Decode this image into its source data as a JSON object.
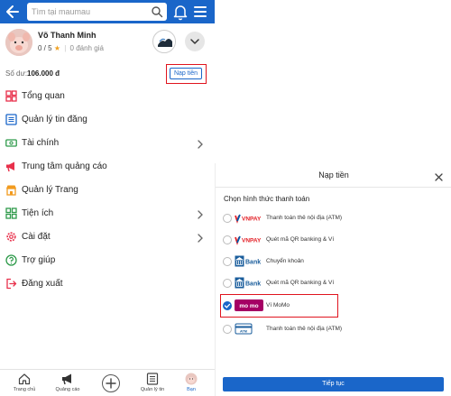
{
  "header": {
    "search_placeholder": "Tìm tại maumau"
  },
  "profile": {
    "name": "Võ Thanh Minh",
    "score": "0 / 5",
    "reviews": "0 đánh giá"
  },
  "balance": {
    "label": "Số dư:",
    "value": "106.000 đ",
    "topup_label": "Nạp tiền"
  },
  "menu": {
    "items": [
      {
        "label": "Tổng quan",
        "icon": "dashboard-icon"
      },
      {
        "label": "Quản lý tin đăng",
        "icon": "list-icon"
      },
      {
        "label": "Tài chính",
        "icon": "money-icon"
      },
      {
        "label": "Trung tâm quảng cáo",
        "icon": "megaphone-icon"
      },
      {
        "label": "Quản lý Trang",
        "icon": "store-icon"
      },
      {
        "label": "Tiện ích",
        "icon": "grid-icon"
      },
      {
        "label": "Cài đặt",
        "icon": "gear-icon"
      },
      {
        "label": "Trợ giúp",
        "icon": "help-icon"
      },
      {
        "label": "Đăng xuất",
        "icon": "logout-icon"
      }
    ]
  },
  "bottom_nav": {
    "tabs": [
      {
        "label": "Trang chủ",
        "icon": "home-icon"
      },
      {
        "label": "Quảng cáo",
        "icon": "megaphone-icon"
      },
      {
        "label": "",
        "icon": "plus-icon"
      },
      {
        "label": "Quản lý tin",
        "icon": "list-icon"
      },
      {
        "label": "Bạn",
        "icon": "avatar-icon"
      }
    ]
  },
  "modal": {
    "title": "Nạp tiền",
    "subtitle": "Chọn hình thức thanh toán",
    "options": [
      {
        "label": "Thanh toán thẻ nội địa (ATM)",
        "logo": "VNPAY",
        "selected": false
      },
      {
        "label": "Quét mã QR banking & Ví",
        "logo": "VNPAY",
        "selected": false
      },
      {
        "label": "Chuyển khoản",
        "logo": "Bank",
        "selected": false
      },
      {
        "label": "Quét mã QR banking & Ví",
        "logo": "Bank",
        "selected": false
      },
      {
        "label": "Ví MoMo",
        "logo": "mo mo",
        "selected": true
      },
      {
        "label": "Thanh toán thẻ nội địa (ATM)",
        "logo": "ATM",
        "selected": false
      }
    ],
    "continue_label": "Tiếp tục"
  },
  "colors": {
    "primary": "#1a66c9",
    "highlight": "#e0141e",
    "momo": "#a50064",
    "vnpay_red": "#e31f26",
    "vnpay_blue": "#005baa",
    "bank": "#1b5e9c",
    "menu_icon_red": "#e8304b",
    "menu_icon_blue": "#1a66c9",
    "menu_icon_green": "#2e9a4a",
    "menu_icon_orange": "#f29b1f"
  }
}
